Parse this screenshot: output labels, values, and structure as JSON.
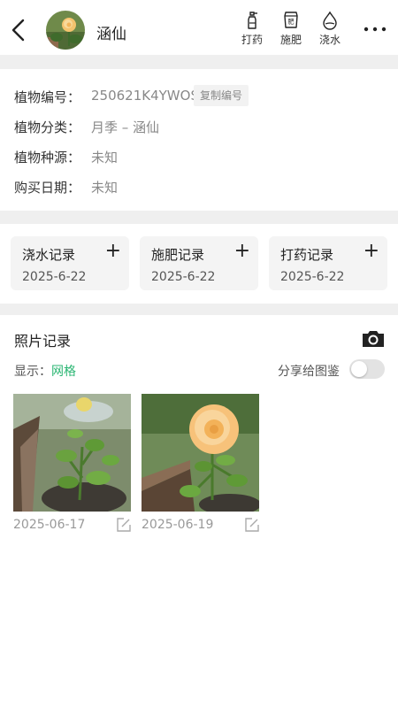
{
  "header": {
    "title": "涵仙",
    "actions": [
      {
        "label": "打药",
        "icon": "spray-bottle-icon"
      },
      {
        "label": "施肥",
        "icon": "fertilizer-bag-icon"
      },
      {
        "label": "浇水",
        "icon": "water-drop-icon"
      }
    ]
  },
  "info": {
    "rows": [
      {
        "key": "植物编号：",
        "value": "250621K4YWOS"
      },
      {
        "key": "植物分类：",
        "value": "月季 – 涵仙"
      },
      {
        "key": "植物种源：",
        "value": "未知"
      },
      {
        "key": "购买日期：",
        "value": "未知"
      }
    ],
    "copy_label": "复制编号"
  },
  "records": [
    {
      "label": "浇水记录",
      "date": "2025-6-22",
      "plus": "+"
    },
    {
      "label": "施肥记录",
      "date": "2025-6-22",
      "plus": "+"
    },
    {
      "label": "打药记录",
      "date": "2025-6-22",
      "plus": "+"
    }
  ],
  "photos": {
    "title": "照片记录",
    "display_label": "显示：",
    "display_mode": "网格",
    "share_label": "分享给图鉴",
    "share_enabled": false,
    "items": [
      {
        "date": "2025-06-17"
      },
      {
        "date": "2025-06-19"
      }
    ]
  },
  "colors": {
    "accent": "#2bb673",
    "separator": "#efefef",
    "card": "#f4f4f4"
  }
}
